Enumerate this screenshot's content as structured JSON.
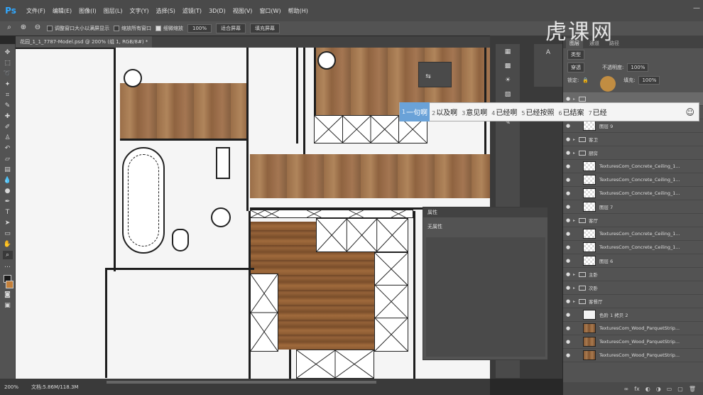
{
  "app": {
    "logo": "Ps",
    "menu": [
      "文件(F)",
      "编辑(E)",
      "图像(I)",
      "图层(L)",
      "文字(Y)",
      "选择(S)",
      "滤镜(T)",
      "3D(D)",
      "视图(V)",
      "窗口(W)",
      "帮助(H)"
    ]
  },
  "options": {
    "resize_windows": "调整窗口大小以满屏显示",
    "zoom_all": "缩放所有窗口",
    "scrubby_zoom": "细微缩放",
    "zoom_value": "100%",
    "fit_screen": "适合屏幕",
    "fill_screen": "填充屏幕"
  },
  "document": {
    "tab_title": "花园_1_1_7787-Model.psd @ 200% (组 1, RGB/8#) *"
  },
  "status": {
    "zoom": "200%",
    "doc_size": "文档:5.86M/118.3M"
  },
  "layers_panel": {
    "tabs": [
      "图层",
      "通道",
      "路径"
    ],
    "kind_label": "类型",
    "blend_mode": "穿透",
    "opacity_label": "不透明度:",
    "opacity_value": "100%",
    "lock_label": "锁定:",
    "fill_label": "填充:",
    "fill_value": "100%",
    "layers": [
      {
        "type": "folder",
        "name": "",
        "indent": 0,
        "selected": true
      },
      {
        "type": "layer",
        "name": "TexturesCom_Wood_ParquetStrip...",
        "thumb": "wood",
        "indent": 1
      },
      {
        "type": "layer",
        "name": "图层 9",
        "thumb": "check",
        "indent": 1
      },
      {
        "type": "folder",
        "name": "客卫",
        "indent": 0
      },
      {
        "type": "folder",
        "name": "厨房",
        "indent": 0
      },
      {
        "type": "layer",
        "name": "TexturesCom_Concrete_Ceiling_1...",
        "thumb": "check",
        "indent": 1
      },
      {
        "type": "layer",
        "name": "TexturesCom_Concrete_Ceiling_1...",
        "thumb": "check",
        "indent": 1
      },
      {
        "type": "layer",
        "name": "TexturesCom_Concrete_Ceiling_1...",
        "thumb": "check",
        "indent": 1
      },
      {
        "type": "layer",
        "name": "图层 7",
        "thumb": "check",
        "indent": 1
      },
      {
        "type": "folder",
        "name": "客厅",
        "indent": 0
      },
      {
        "type": "layer",
        "name": "TexturesCom_Concrete_Ceiling_1...",
        "thumb": "check",
        "indent": 1
      },
      {
        "type": "layer",
        "name": "TexturesCom_Concrete_Ceiling_1...",
        "thumb": "check",
        "indent": 1
      },
      {
        "type": "layer",
        "name": "图层 6",
        "thumb": "check",
        "indent": 1
      },
      {
        "type": "folder",
        "name": "主卧",
        "indent": 0
      },
      {
        "type": "folder",
        "name": "次卧",
        "indent": 0
      },
      {
        "type": "folder",
        "name": "客餐厅",
        "indent": 0
      },
      {
        "type": "adjust",
        "name": "色阶 1 拷贝 2",
        "thumb": "white",
        "indent": 1
      },
      {
        "type": "layer",
        "name": "TexturesCom_Wood_ParquetStrip...",
        "thumb": "wood",
        "indent": 1
      },
      {
        "type": "layer",
        "name": "TexturesCom_Wood_ParquetStrip...",
        "thumb": "wood",
        "indent": 1
      },
      {
        "type": "layer",
        "name": "TexturesCom_Wood_ParquetStrip...",
        "thumb": "wood",
        "indent": 1
      }
    ]
  },
  "properties_panel": {
    "title": "属性",
    "body": "无属性"
  },
  "ime": {
    "candidates": [
      {
        "n": "1",
        "text": "一句啊"
      },
      {
        "n": "2",
        "text": "以及啊"
      },
      {
        "n": "3",
        "text": "意见啊"
      },
      {
        "n": "4",
        "text": "已经啊"
      },
      {
        "n": "5",
        "text": "已经按照"
      },
      {
        "n": "6",
        "text": "已结案"
      },
      {
        "n": "7",
        "text": "已经"
      }
    ]
  },
  "colors": {
    "accent": "#31a8ff",
    "ime_highlight": "#6aa2d8",
    "panel_bg": "#535353"
  }
}
